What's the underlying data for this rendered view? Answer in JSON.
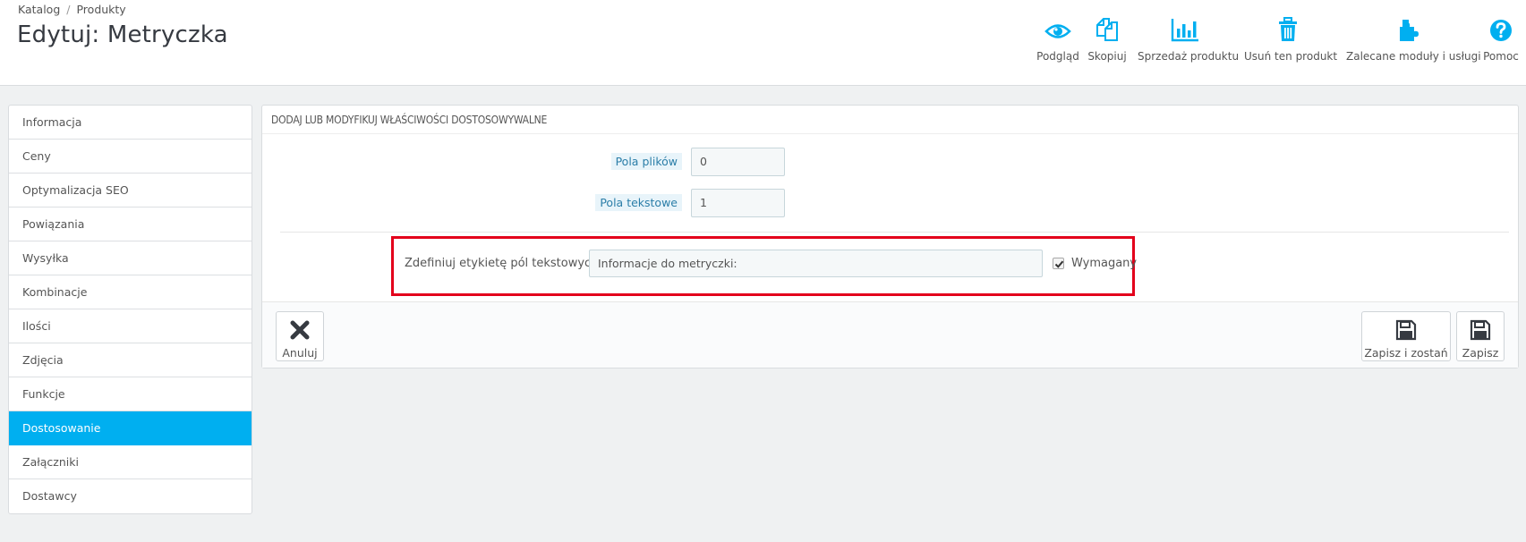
{
  "breadcrumb": {
    "item1": "Katalog",
    "separator": "/",
    "item2": "Produkty"
  },
  "title": "Edytuj: Metryczka",
  "toolbar": {
    "preview": "Podgląd",
    "copy": "Skopiuj",
    "sales": "Sprzedaż produktu",
    "delete": "Usuń ten produkt",
    "modules": "Zalecane moduły i usługi",
    "help": "Pomoc",
    "icon_color": "#00aff0"
  },
  "sidebar": {
    "items": [
      {
        "label": "Informacja"
      },
      {
        "label": "Ceny"
      },
      {
        "label": "Optymalizacja SEO"
      },
      {
        "label": "Powiązania"
      },
      {
        "label": "Wysyłka"
      },
      {
        "label": "Kombinacje"
      },
      {
        "label": "Ilości"
      },
      {
        "label": "Zdjęcia"
      },
      {
        "label": "Funkcje"
      },
      {
        "label": "Dostosowanie",
        "active": true
      },
      {
        "label": "Załączniki"
      },
      {
        "label": "Dostawcy"
      }
    ]
  },
  "panel": {
    "heading": "DODAJ LUB MODYFIKUJ WŁAŚCIWOŚCI DOSTOSOWYWALNE",
    "file_fields": {
      "label": "Pola plików",
      "value": "0"
    },
    "text_fields": {
      "label": "Pola tekstowe",
      "value": "1"
    },
    "define": {
      "label": "Zdefiniuj etykietę pól tekstowych",
      "value": "Informacje do metryczki:",
      "required_label": "Wymagany",
      "required_checked": true
    },
    "footer": {
      "cancel": "Anuluj",
      "save_stay": "Zapisz i zostań",
      "save": "Zapisz"
    }
  }
}
